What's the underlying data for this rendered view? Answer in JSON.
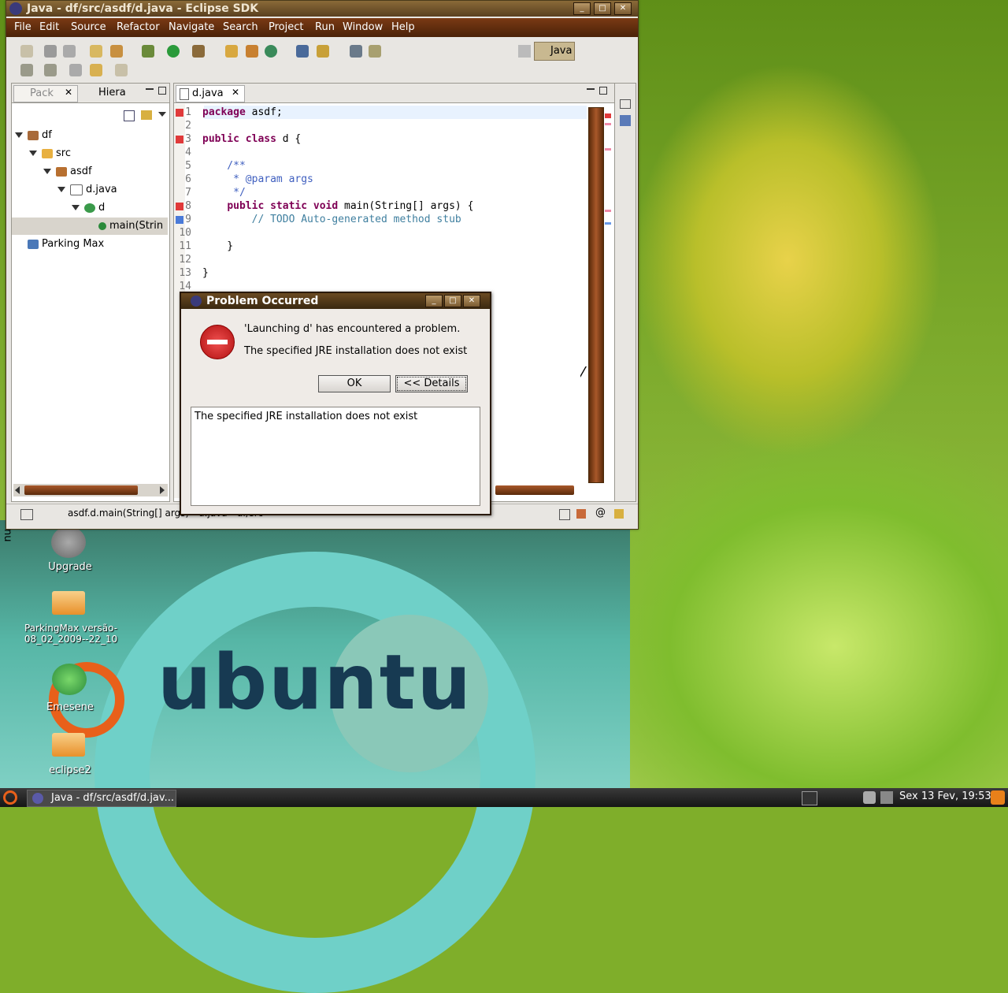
{
  "window": {
    "title": "Java - df/src/asdf/d.java - Eclipse SDK",
    "buttons": [
      "minimize",
      "maximize",
      "close"
    ]
  },
  "menu": [
    "File",
    "Edit",
    "Source",
    "Refactor",
    "Navigate",
    "Search",
    "Project",
    "Run",
    "Window",
    "Help"
  ],
  "perspective": {
    "label": "Java"
  },
  "package_explorer": {
    "tabs": [
      "Pack",
      "Hiera"
    ],
    "tree": [
      {
        "label": "df",
        "depth": 0
      },
      {
        "label": "src",
        "depth": 1
      },
      {
        "label": "asdf",
        "depth": 2
      },
      {
        "label": "d.java",
        "depth": 3
      },
      {
        "label": "d",
        "depth": 4
      },
      {
        "label": "main(Strin",
        "depth": 5
      },
      {
        "label": "Parking Max",
        "depth": 0
      }
    ]
  },
  "editor": {
    "tab": "d.java",
    "lines": [
      {
        "n": "1",
        "text": "package asdf;"
      },
      {
        "n": "2",
        "text": ""
      },
      {
        "n": "3",
        "text": "public class d {"
      },
      {
        "n": "4",
        "text": ""
      },
      {
        "n": "5",
        "text": "    /**"
      },
      {
        "n": "6",
        "text": "     * @param args"
      },
      {
        "n": "7",
        "text": "     */"
      },
      {
        "n": "8",
        "text": "    public static void main(String[] args) {"
      },
      {
        "n": "9",
        "text": "        // TODO Auto-generated method stub"
      },
      {
        "n": "10",
        "text": ""
      },
      {
        "n": "11",
        "text": "    }"
      },
      {
        "n": "12",
        "text": ""
      },
      {
        "n": "13",
        "text": "}"
      },
      {
        "n": "14",
        "text": ""
      }
    ]
  },
  "statusbar": {
    "text": "asdf.d.main(String[] args) - d.java - df/src"
  },
  "dialog": {
    "title": "Problem Occurred",
    "message": "'Launching d' has encountered a problem.",
    "detail": "The specified JRE installation does not exist",
    "ok": "OK",
    "details_button": "<< Details",
    "details_text": "The specified JRE installation does not exist"
  },
  "desktop": {
    "icons": [
      {
        "label": "Upgrade"
      },
      {
        "label": "ParkingMax versão-08_02_2009--22_10"
      },
      {
        "label": "Emesene"
      },
      {
        "label": "eclipse2"
      }
    ],
    "wallpaper_text": "ubuntu",
    "side_text": "nu"
  },
  "taskbar": {
    "task": "Java - df/src/asdf/d.jav...",
    "clock": "Sex 13 Fev, 19:53"
  }
}
